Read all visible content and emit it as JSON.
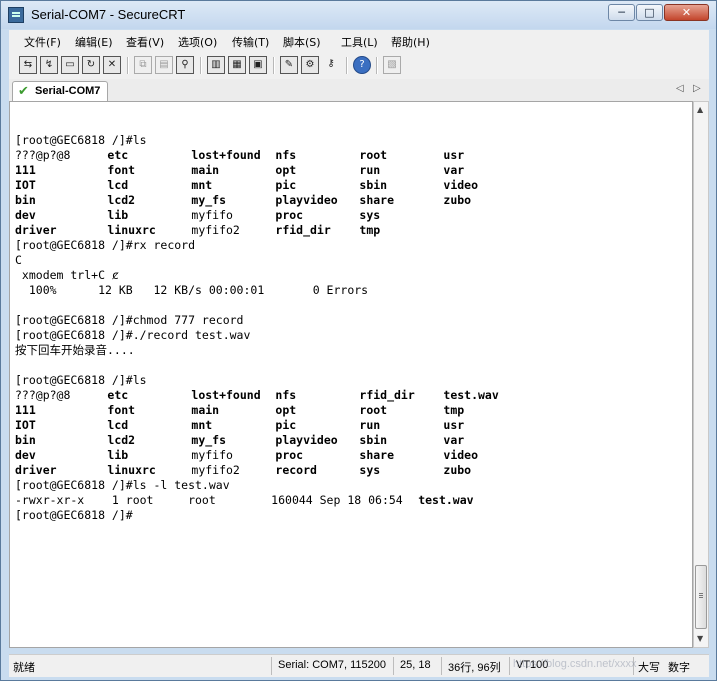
{
  "window": {
    "title": "Serial-COM7 - SecureCRT",
    "minimize": "─",
    "maximize": "□",
    "close": "✕"
  },
  "menu": [
    "文件(F)",
    "编辑(E)",
    "查看(V)",
    "选项(O)",
    "传输(T)",
    "脚本(S)",
    "工具(L)",
    "帮助(H)"
  ],
  "toolbar_icons": [
    "connect-icon",
    "quick-connect-icon",
    "connect-tab-icon",
    "reconnect-icon",
    "disconnect-icon",
    "copy-icon",
    "paste-icon",
    "find-icon",
    "print-icon",
    "print-setup-icon",
    "print-screen-icon",
    "session-options-icon",
    "keymap-icon",
    "sftp-icon",
    "help-icon",
    "log-icon"
  ],
  "tab": {
    "label": "Serial-COM7",
    "prev": "◁",
    "next": "▷"
  },
  "terminal": {
    "lines": [
      {
        "cells": [
          {
            "t": "[root@GEC6818 /]#ls",
            "b": false,
            "c": 0
          }
        ]
      },
      {
        "cells": [
          {
            "t": "???@p?@8",
            "b": false,
            "c": 0
          },
          {
            "t": "etc",
            "b": true,
            "c": 11
          },
          {
            "t": "lost+found",
            "b": true,
            "c": 21
          },
          {
            "t": "nfs",
            "b": true,
            "c": 31
          },
          {
            "t": "root",
            "b": true,
            "c": 41
          },
          {
            "t": "usr",
            "b": true,
            "c": 51
          }
        ]
      },
      {
        "cells": [
          {
            "t": "111",
            "b": true,
            "c": 0
          },
          {
            "t": "font",
            "b": true,
            "c": 11
          },
          {
            "t": "main",
            "b": true,
            "c": 21
          },
          {
            "t": "opt",
            "b": true,
            "c": 31
          },
          {
            "t": "run",
            "b": true,
            "c": 41
          },
          {
            "t": "var",
            "b": true,
            "c": 51
          }
        ]
      },
      {
        "cells": [
          {
            "t": "IOT",
            "b": true,
            "c": 0
          },
          {
            "t": "lcd",
            "b": true,
            "c": 11
          },
          {
            "t": "mnt",
            "b": true,
            "c": 21
          },
          {
            "t": "pic",
            "b": true,
            "c": 31
          },
          {
            "t": "sbin",
            "b": true,
            "c": 41
          },
          {
            "t": "video",
            "b": true,
            "c": 51
          }
        ]
      },
      {
        "cells": [
          {
            "t": "bin",
            "b": true,
            "c": 0
          },
          {
            "t": "lcd2",
            "b": true,
            "c": 11
          },
          {
            "t": "my_fs",
            "b": true,
            "c": 21
          },
          {
            "t": "playvideo",
            "b": true,
            "c": 31
          },
          {
            "t": "share",
            "b": true,
            "c": 41
          },
          {
            "t": "zubo",
            "b": true,
            "c": 51
          }
        ]
      },
      {
        "cells": [
          {
            "t": "dev",
            "b": true,
            "c": 0
          },
          {
            "t": "lib",
            "b": true,
            "c": 11
          },
          {
            "t": "myfifo",
            "b": false,
            "c": 21
          },
          {
            "t": "proc",
            "b": true,
            "c": 31
          },
          {
            "t": "sys",
            "b": true,
            "c": 41
          }
        ]
      },
      {
        "cells": [
          {
            "t": "driver",
            "b": true,
            "c": 0
          },
          {
            "t": "linuxrc",
            "b": true,
            "c": 11
          },
          {
            "t": "myfifo2",
            "b": false,
            "c": 21
          },
          {
            "t": "rfid_dir",
            "b": true,
            "c": 31
          },
          {
            "t": "tmp",
            "b": true,
            "c": 41
          }
        ]
      },
      {
        "cells": [
          {
            "t": "[root@GEC6818 /]#rx record",
            "b": false,
            "c": 0
          }
        ]
      },
      {
        "cells": [
          {
            "t": "C",
            "b": false,
            "c": 0
          }
        ]
      },
      {
        "cells": [
          {
            "t": " xmodem trl+C ȼ",
            "b": false,
            "c": 0
          }
        ]
      },
      {
        "cells": [
          {
            "t": "  100%      12 KB   12 KB/s 00:00:01       0 Errors",
            "b": false,
            "c": 0
          }
        ]
      },
      {
        "cells": []
      },
      {
        "cells": [
          {
            "t": "[root@GEC6818 /]#chmod 777 record",
            "b": false,
            "c": 0
          }
        ]
      },
      {
        "cells": [
          {
            "t": "[root@GEC6818 /]#./record test.wav",
            "b": false,
            "c": 0
          }
        ]
      },
      {
        "cells": [
          {
            "t": "按下回车开始录音....",
            "b": false,
            "c": 0
          }
        ]
      },
      {
        "cells": []
      },
      {
        "cells": [
          {
            "t": "[root@GEC6818 /]#ls",
            "b": false,
            "c": 0
          }
        ]
      },
      {
        "cells": [
          {
            "t": "???@p?@8",
            "b": false,
            "c": 0
          },
          {
            "t": "etc",
            "b": true,
            "c": 11
          },
          {
            "t": "lost+found",
            "b": true,
            "c": 21
          },
          {
            "t": "nfs",
            "b": true,
            "c": 31
          },
          {
            "t": "rfid_dir",
            "b": true,
            "c": 41
          },
          {
            "t": "test.wav",
            "b": true,
            "c": 51
          }
        ]
      },
      {
        "cells": [
          {
            "t": "111",
            "b": true,
            "c": 0
          },
          {
            "t": "font",
            "b": true,
            "c": 11
          },
          {
            "t": "main",
            "b": true,
            "c": 21
          },
          {
            "t": "opt",
            "b": true,
            "c": 31
          },
          {
            "t": "root",
            "b": true,
            "c": 41
          },
          {
            "t": "tmp",
            "b": true,
            "c": 51
          }
        ]
      },
      {
        "cells": [
          {
            "t": "IOT",
            "b": true,
            "c": 0
          },
          {
            "t": "lcd",
            "b": true,
            "c": 11
          },
          {
            "t": "mnt",
            "b": true,
            "c": 21
          },
          {
            "t": "pic",
            "b": true,
            "c": 31
          },
          {
            "t": "run",
            "b": true,
            "c": 41
          },
          {
            "t": "usr",
            "b": true,
            "c": 51
          }
        ]
      },
      {
        "cells": [
          {
            "t": "bin",
            "b": true,
            "c": 0
          },
          {
            "t": "lcd2",
            "b": true,
            "c": 11
          },
          {
            "t": "my_fs",
            "b": true,
            "c": 21
          },
          {
            "t": "playvideo",
            "b": true,
            "c": 31
          },
          {
            "t": "sbin",
            "b": true,
            "c": 41
          },
          {
            "t": "var",
            "b": true,
            "c": 51
          }
        ]
      },
      {
        "cells": [
          {
            "t": "dev",
            "b": true,
            "c": 0
          },
          {
            "t": "lib",
            "b": true,
            "c": 11
          },
          {
            "t": "myfifo",
            "b": false,
            "c": 21
          },
          {
            "t": "proc",
            "b": true,
            "c": 31
          },
          {
            "t": "share",
            "b": true,
            "c": 41
          },
          {
            "t": "video",
            "b": true,
            "c": 51
          }
        ]
      },
      {
        "cells": [
          {
            "t": "driver",
            "b": true,
            "c": 0
          },
          {
            "t": "linuxrc",
            "b": true,
            "c": 11
          },
          {
            "t": "myfifo2",
            "b": false,
            "c": 21
          },
          {
            "t": "record",
            "b": true,
            "c": 31
          },
          {
            "t": "sys",
            "b": true,
            "c": 41
          },
          {
            "t": "zubo",
            "b": true,
            "c": 51
          }
        ]
      },
      {
        "cells": [
          {
            "t": "[root@GEC6818 /]#ls -l test.wav",
            "b": false,
            "c": 0
          }
        ]
      },
      {
        "cells": [
          {
            "t": "-rwxr-xr-x    1 root     root        160044 Sep 18 06:54 ",
            "b": false,
            "c": 0
          },
          {
            "t": "test.wav",
            "b": true,
            "c": 48
          }
        ]
      },
      {
        "cells": [
          {
            "t": "[root@GEC6818 /]#",
            "b": false,
            "c": 0
          }
        ]
      }
    ]
  },
  "status": {
    "ready": "就绪",
    "connection": "Serial: COM7, 115200",
    "cursor": "25, 18",
    "size": "36行, 96列",
    "emulation": "VT100",
    "caps": "大写",
    "num": "数字"
  },
  "watermark": "https://blog.csdn.net/xxxx"
}
